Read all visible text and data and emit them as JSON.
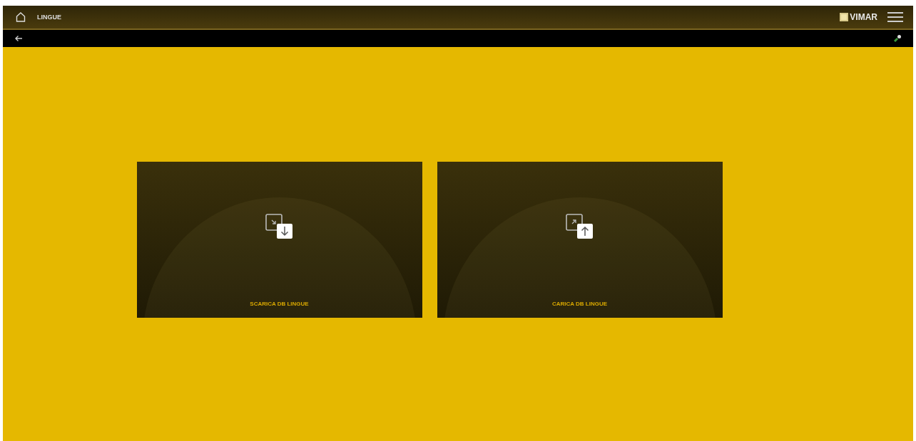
{
  "header": {
    "title": "LINGUE",
    "brand": "VIMAR"
  },
  "cards": [
    {
      "label": "SCARICA DB LINGUE",
      "kind": "download"
    },
    {
      "label": "CARICA DB LINGUE",
      "kind": "upload"
    }
  ]
}
